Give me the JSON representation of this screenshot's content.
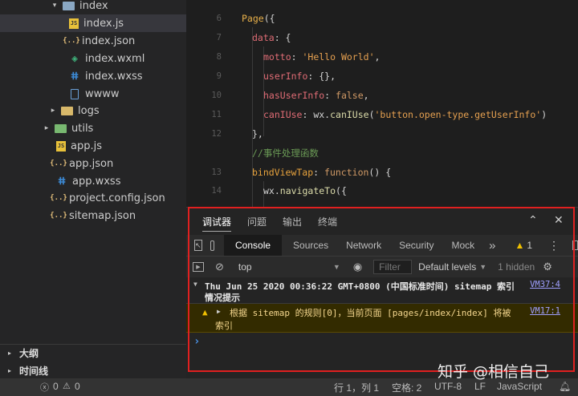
{
  "sidebar": {
    "items": [
      {
        "label": "index",
        "icon": "folder-icon",
        "arrow": "▾"
      },
      {
        "label": "index.js",
        "icon": "js-icon",
        "badge": "JS"
      },
      {
        "label": "index.json",
        "icon": "json-icon",
        "badge": "{..}"
      },
      {
        "label": "index.wxml",
        "icon": "wxml-icon",
        "badge": "◈"
      },
      {
        "label": "index.wxss",
        "icon": "wxss-icon",
        "badge": "ⵌ"
      },
      {
        "label": "wwww",
        "icon": "file-icon"
      },
      {
        "label": "logs",
        "icon": "folder-icon",
        "arrow": "▸"
      },
      {
        "label": "utils",
        "icon": "folder-icon",
        "arrow": "▸"
      },
      {
        "label": "app.js",
        "icon": "js-icon",
        "badge": "JS"
      },
      {
        "label": "app.json",
        "icon": "json-icon",
        "badge": "{..}"
      },
      {
        "label": "app.wxss",
        "icon": "wxss-icon",
        "badge": "ⵌ"
      },
      {
        "label": "project.config.json",
        "icon": "json-icon",
        "badge": "{..}"
      },
      {
        "label": "sitemap.json",
        "icon": "json-icon",
        "badge": "{..}"
      }
    ],
    "sections": {
      "outline": "大纲",
      "timeline": "时间线"
    }
  },
  "editor": {
    "line_numbers": [
      "6",
      "7",
      "8",
      "9",
      "10",
      "11",
      "12",
      "13",
      "14"
    ],
    "code": {
      "l6_a": "Page",
      "l6_b": "({",
      "l7_a": "data",
      "l7_b": ": {",
      "l8_a": "motto",
      "l8_b": ": ",
      "l8_c": "'Hello World'",
      "l8_d": ",",
      "l9_a": "userInfo",
      "l9_b": ": {},",
      "l10_a": "hasUserInfo",
      "l10_b": ": ",
      "l10_c": "false",
      "l10_d": ",",
      "l11_a": "canIUse",
      "l11_b": ": wx.",
      "l11_c": "canIUse",
      "l11_d": "(",
      "l11_e": "'button.open-type.getUserInfo'",
      "l11_f": ")",
      "l12": "},",
      "l13": "//事件处理函数",
      "l14_a": "bindViewTap",
      "l14_b": ": ",
      "l14_c": "function",
      "l14_d": "() {",
      "l15_a": "wx.",
      "l15_b": "navigateTo",
      "l15_c": "({"
    }
  },
  "debugger": {
    "panel_tabs": [
      "调试器",
      "问题",
      "输出",
      "终端"
    ],
    "active_panel_tab": "调试器",
    "tabs": [
      "Console",
      "Sources",
      "Network",
      "Security",
      "Mock"
    ],
    "more": "»",
    "warning_count": "1",
    "context": "top",
    "filter_placeholder": "Filter",
    "levels": "Default levels",
    "hidden": "1 hidden",
    "log_group_line1": "Thu Jun 25 2020 00:36:22 GMT+0800 (中国标准时间) sitemap 索引",
    "log_group_line2": "情况提示",
    "log_group_link": "VM37:4",
    "warn_line1": "根据 sitemap 的规则[0]，当前页面 [pages/index/index] 将被",
    "warn_line2": "索引",
    "warn_link": "VM17:1",
    "prompt": "›"
  },
  "statusbar": {
    "errors": "0",
    "warnings": "0",
    "position": "行 1，列 1",
    "spaces": "空格: 2",
    "encoding": "UTF-8",
    "eol": "LF",
    "language": "JavaScript"
  },
  "watermark": "知乎 @相信自己"
}
